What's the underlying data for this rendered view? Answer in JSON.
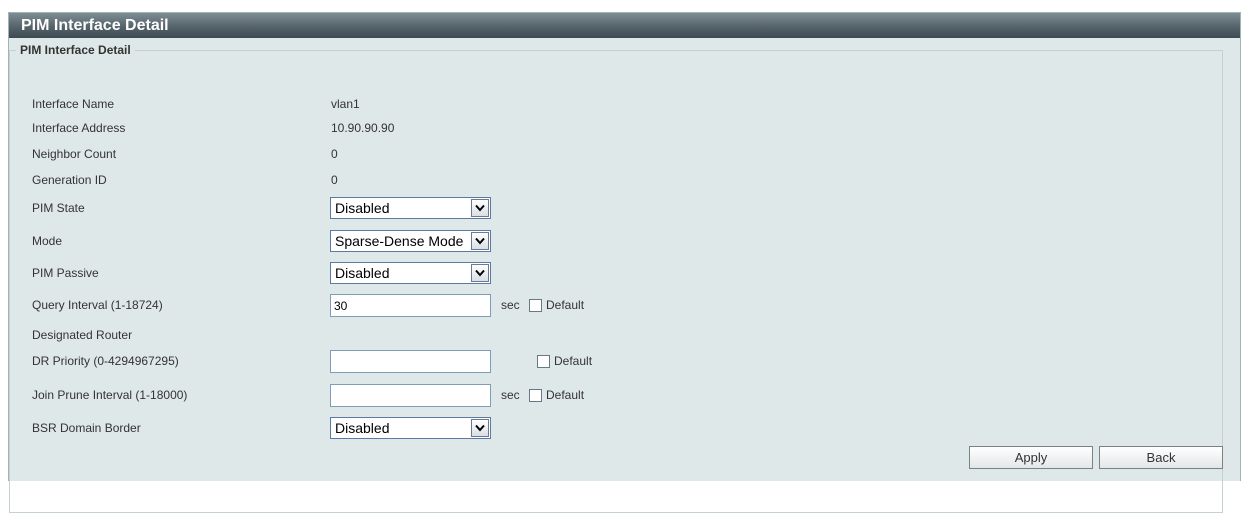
{
  "title": "PIM Interface Detail",
  "fieldset_legend": "PIM Interface Detail",
  "rows": {
    "interface_name": {
      "label": "Interface Name",
      "value": "vlan1"
    },
    "interface_address": {
      "label": "Interface Address",
      "value": "10.90.90.90"
    },
    "neighbor_count": {
      "label": "Neighbor Count",
      "value": "0"
    },
    "generation_id": {
      "label": "Generation ID",
      "value": "0"
    },
    "pim_state": {
      "label": "PIM State",
      "selected": "Disabled"
    },
    "mode": {
      "label": "Mode",
      "selected": "Sparse-Dense Mode"
    },
    "pim_passive": {
      "label": "PIM Passive",
      "selected": "Disabled"
    },
    "query_interval": {
      "label": "Query Interval (1-18724)",
      "value": "30",
      "unit": "sec",
      "checkbox_label": "Default"
    },
    "designated_router": {
      "label": "Designated Router"
    },
    "dr_priority": {
      "label": "DR Priority (0-4294967295)",
      "value": "",
      "checkbox_label": "Default"
    },
    "join_prune_interval": {
      "label": "Join Prune Interval (1-18000)",
      "value": "",
      "unit": "sec",
      "checkbox_label": "Default"
    },
    "bsr_domain_border": {
      "label": "BSR Domain Border",
      "selected": "Disabled"
    }
  },
  "buttons": {
    "apply": "Apply",
    "back": "Back"
  },
  "icons": {
    "dropdown": "chevron-down-icon"
  },
  "colors": {
    "title_bar": "#55636b",
    "panel_bg": "#dfe8e8",
    "select_border": "#5d79a8"
  }
}
